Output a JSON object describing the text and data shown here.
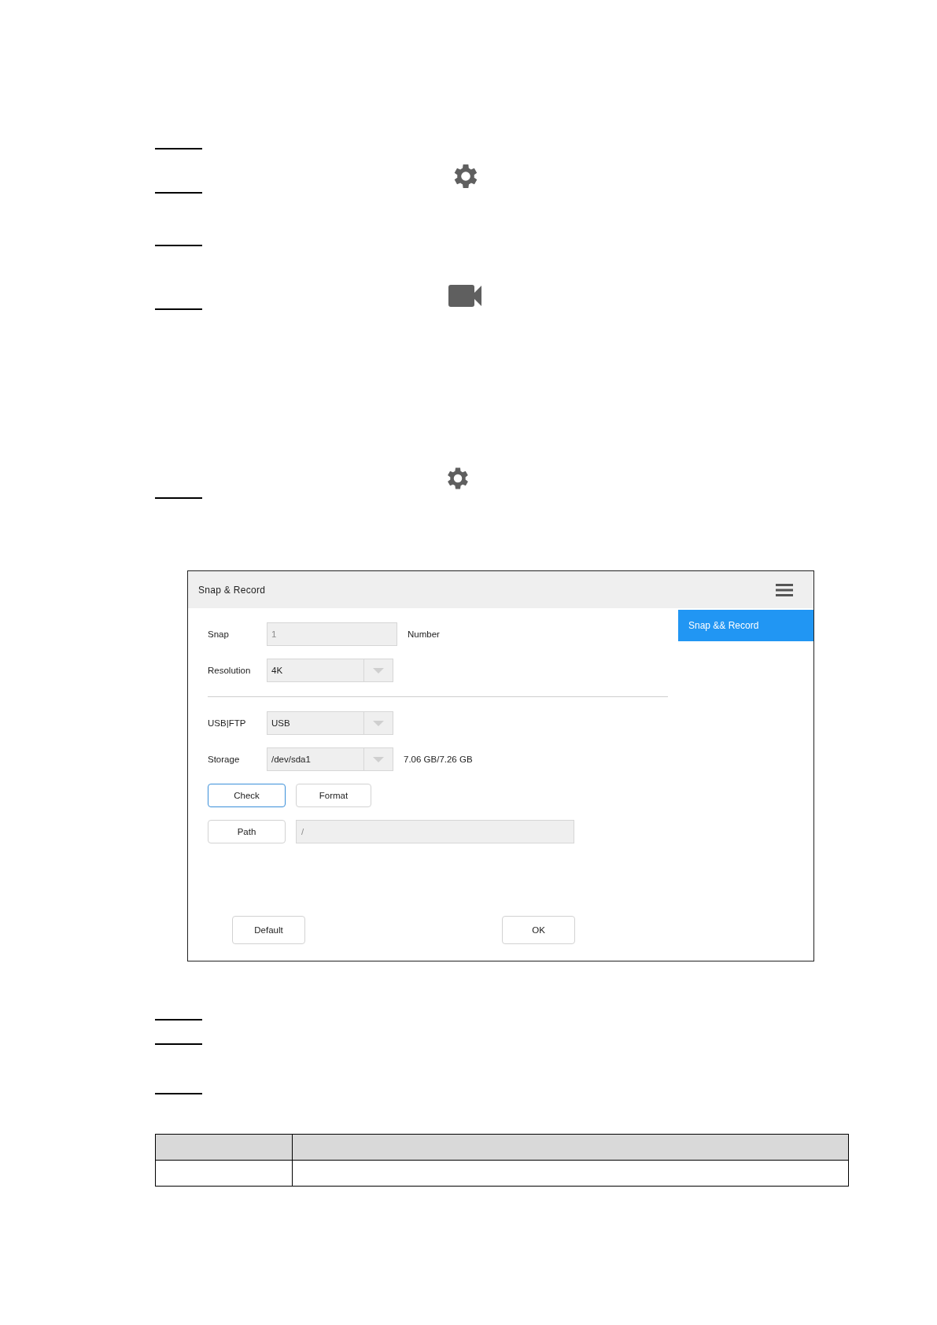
{
  "dialog": {
    "title": "Snap & Record",
    "menu_items": [
      {
        "label": "Snap && Record",
        "selected": true
      }
    ],
    "sections": [
      [
        {
          "kind": "input",
          "label": "Snap",
          "value": "1",
          "disabled": true,
          "note": "Number"
        },
        {
          "kind": "select",
          "label": "Resolution",
          "value": "4K"
        }
      ],
      [
        {
          "kind": "select",
          "label": "USB|FTP",
          "value": "USB"
        },
        {
          "kind": "select",
          "label": "Storage",
          "value": "/dev/sda1",
          "note": "7.06 GB/7.26 GB"
        }
      ]
    ],
    "actions": [
      {
        "label": "Check",
        "focused": true
      },
      {
        "label": "Format",
        "focused": false
      }
    ],
    "path": {
      "label": "Path",
      "value": "/",
      "disabled": true
    },
    "footer_buttons": [
      "Default",
      "OK"
    ]
  }
}
